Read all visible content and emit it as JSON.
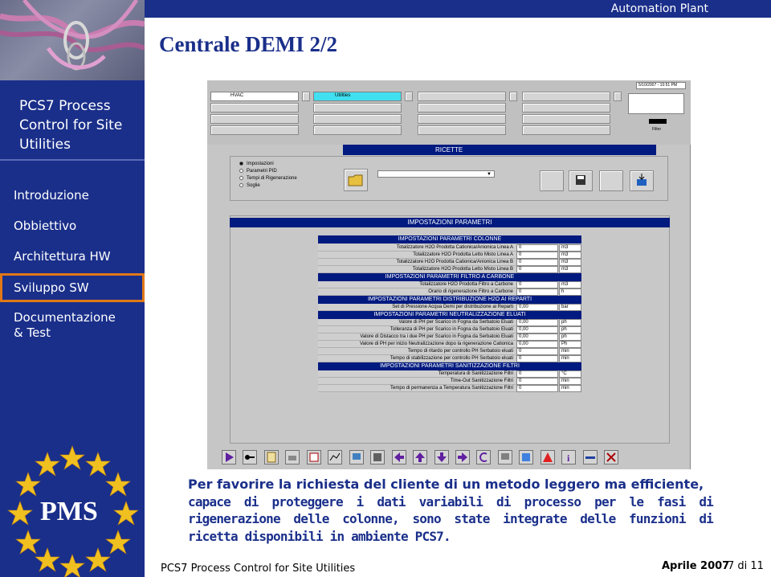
{
  "header": {
    "banner_text": "Automation Plant",
    "title": "Centrale DEMI 2/2"
  },
  "sidebar": {
    "heading": [
      "PCS7 Process",
      "Control for Site",
      "Utilities"
    ],
    "items": [
      {
        "label": "Introduzione",
        "active": false
      },
      {
        "label": "Obbiettivo",
        "active": false
      },
      {
        "label": "Architettura HW",
        "active": false
      },
      {
        "label": "Sviluppo SW",
        "active": true
      },
      {
        "label": "Documentazione",
        "active": false
      },
      {
        "label": "& Test",
        "active": false
      }
    ],
    "logo_text": "PMS"
  },
  "screenshot": {
    "tabs": [
      "HVAC",
      "Utilities"
    ],
    "date_field": "5/10/2007 - 10:51 PM",
    "filter_label": "Filter",
    "ricette_label": "RICETTE",
    "recipe_options": [
      "Impostazioni",
      "Parametri PID",
      "Tempi di Rigenerazione",
      "Soglie"
    ],
    "params_title": "IMPOSTAZIONI PARAMETRI",
    "sections": [
      {
        "title": "IMPOSTAZIONI PARAMETRI COLONNE",
        "rows": [
          {
            "label": "Totalizzatore H2O Prodotta Cationica/Anionica Linea A",
            "value": "0",
            "unit": "m3"
          },
          {
            "label": "Totalizzatore H2O Prodotta Letto Misto Linea A",
            "value": "0",
            "unit": "m3"
          },
          {
            "label": "Totalizzatore H2O Prodotta Cationica/Anionica Linea B",
            "value": "0",
            "unit": "m3"
          },
          {
            "label": "Totalizzatore H2O Prodotta Letto Misto Linea B",
            "value": "0",
            "unit": "m3"
          }
        ]
      },
      {
        "title": "IMPOSTAZIONI PARAMETRI FILTRO A CARBONE",
        "rows": [
          {
            "label": "Totalizzatore H2O Prodotta Filtro a Carbone",
            "value": "0",
            "unit": "m3"
          },
          {
            "label": "Orario di rigenerazione Filtro a Carbone",
            "value": "0",
            "unit": "h"
          }
        ]
      },
      {
        "title": "IMPOSTAZIONI PARAMETRI DISTRIBUZIONE H2O AI REPARTI",
        "rows": [
          {
            "label": "Set di Pressione Acqua Demi per distribuzione ai Reparti",
            "value": "0,00",
            "unit": "bar"
          }
        ]
      },
      {
        "title": "IMPOSTAZIONI PARAMETRI NEUTRALIZZAZIONE ELUATI",
        "rows": [
          {
            "label": "Valore di PH per Scarico in Fogna da Serbatoio Eluati",
            "value": "0,00",
            "unit": "ph"
          },
          {
            "label": "Tolleranza di PH per Scarico in Fogna da Serbatoio Eluati",
            "value": "0,00",
            "unit": "ph"
          },
          {
            "label": "Valore di Distacco tra i due PH per Scarico in Fogna da Serbatoio Eluati",
            "value": "0,00",
            "unit": "ph"
          },
          {
            "label": "Valore di PH per inizio Neutralizzazione dopo la rigenerazione Cationica",
            "value": "0,00",
            "unit": "Ph"
          },
          {
            "label": "Tempo di ritardo per controllo PH Serbatoio eluati",
            "value": "0",
            "unit": "min"
          },
          {
            "label": "Tempo di stabilizzazione per controllo PH Serbatoio eluati",
            "value": "0",
            "unit": "min"
          }
        ]
      },
      {
        "title": "IMPOSTAZIONI PARAMETRI SANITIZZAZIONE FILTRI",
        "rows": [
          {
            "label": "Temperatura di Sanitizzazione Filtri",
            "value": "0",
            "unit": "°C"
          },
          {
            "label": "Time-Out Sanitizzazione Filtri",
            "value": "0",
            "unit": "min"
          },
          {
            "label": "Tempo di permanenza a Temperatura Sanitizzazione Filtri",
            "value": "0",
            "unit": "min"
          }
        ]
      }
    ]
  },
  "caption": {
    "first_line": "Per favorire la richiesta del cliente di un metodo leggero ma efficiente,",
    "rest": "capace di proteggere i dati variabili di processo per le fasi di rigenerazione delle colonne, sono state integrate delle funzioni di ricetta disponibili in ambiente PCS7."
  },
  "footer": {
    "left": "PCS7 Process Control for Site Utilities",
    "date": "Aprile 2007",
    "page": "7 di 11"
  },
  "colors": {
    "navy": "#1a2f8a",
    "active_border": "#e07818",
    "panel_grey": "#c8c8c8",
    "header_navy": "#001a80"
  }
}
